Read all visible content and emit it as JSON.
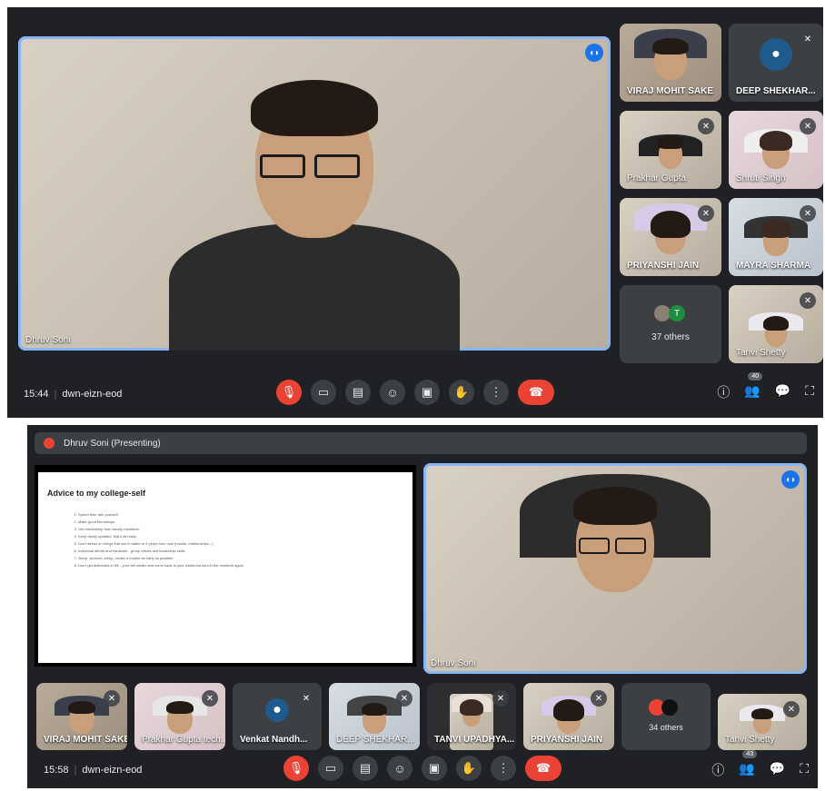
{
  "screenshot_1": {
    "main_tile": {
      "name": "Dhruv Soni"
    },
    "tiles": [
      {
        "name": "VIRAJ MOHIT SAKE"
      },
      {
        "name": "DEEP SHEKHAR..."
      },
      {
        "name": "Prakhar Gupta"
      },
      {
        "name": "Shruti Singh"
      },
      {
        "name": "PRIYANSHI JAIN"
      },
      {
        "name": "MAYRA SHARMA"
      },
      {
        "name": "Tanvi Shetty"
      }
    ],
    "others": {
      "label": "37 others",
      "avatar_letter": "T"
    },
    "meeting": {
      "time": "15:44",
      "code": "dwn-eizn-eod"
    },
    "people_count": "40"
  },
  "screenshot_2": {
    "presenting_banner": "Dhruv Soni (Presenting)",
    "slide": {
      "title": "Advice to my college-self",
      "items": [
        "Spend time with yourself",
        "Make good friendships",
        "Get mentorship from faculty members",
        "Keep family updated, that's all really",
        "Don't stress on things that won't matter in 5 years from now (results, relationships...)",
        "Individual efforts and hardwork - group efforts and leadership skills",
        "Sleep, workout, sleep, create a routine as early as possible",
        "Don't get distracted in life - your will matter and come back to your childhood soul in the research again"
      ]
    },
    "main_tile": {
      "name": "Dhruv Soni"
    },
    "tiles": [
      {
        "name": "VIRAJ MOHIT SAKE"
      },
      {
        "name": "Prakhar Gupta tech..."
      },
      {
        "name": "Venkat Nandh..."
      },
      {
        "name": "DEEP SHEKHAR..."
      },
      {
        "name": "TANVI UPADHYA..."
      },
      {
        "name": "PRIYANSHI JAIN"
      },
      {
        "name": "Tanvi Shetty"
      }
    ],
    "others": {
      "label": "34 others"
    },
    "meeting": {
      "time": "15:58",
      "code": "dwn-eizn-eod"
    },
    "people_count": "43"
  },
  "icons": {
    "mic": "mic-off-icon",
    "camera": "camera-icon",
    "captions": "captions-icon",
    "emoji": "emoji-icon",
    "present": "present-icon",
    "hand": "raise-hand-icon",
    "more": "more-options-icon",
    "leave": "leave-call-icon"
  },
  "colors": {
    "accent": "#8ab4f8",
    "danger": "#ea4335",
    "bg": "#202124",
    "speaking": "#1a73e8"
  }
}
